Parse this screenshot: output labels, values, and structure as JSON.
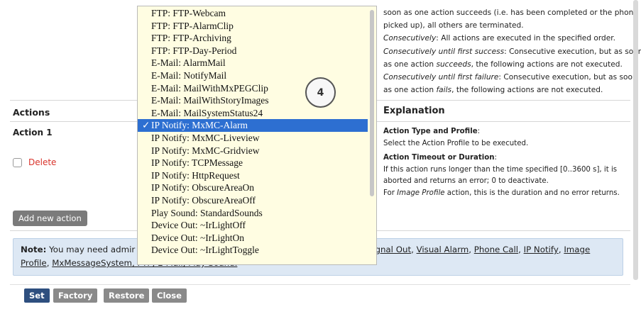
{
  "top_explanation": {
    "line1": "soon as one action succeeds (i.e. has been completed or the phone is",
    "line2": "picked up), all others are terminated.",
    "line3_em": "Consecutively",
    "line3_rest": ": All actions are executed in the specified order.",
    "line4_em": "Consecutively until first success",
    "line4_rest": ": Consecutive execution, but as soon",
    "line5_pre": "as one action ",
    "line5_em": "succeeds",
    "line5_rest": ", the following actions are not executed.",
    "line6_em": "Consecutively until first failure",
    "line6_rest": ": Consecutive execution, but as soon",
    "line7_pre": "as one action ",
    "line7_em": "fails",
    "line7_rest": ", the following actions are not executed."
  },
  "table": {
    "actions_header": "Actions",
    "explanation_header": "Explanation",
    "action_name": "Action 1",
    "delete_label": "Delete",
    "delete_checked": false
  },
  "explanation": {
    "type_title": "Action Type and Profile",
    "type_colon": ":",
    "type_text": "Select the Action Profile to be executed.",
    "timeout_title": "Action Timeout or Duration",
    "timeout_colon": ":",
    "timeout_line1": "If this action runs longer than the time specified [0..3600 s], it is",
    "timeout_line2": "aborted and returns an error; 0 to deactivate.",
    "timeout_line3_pre": "For ",
    "timeout_line3_em": "Image Profile",
    "timeout_line3_rest": " action, this is the duration and no error returns."
  },
  "add_button": "Add new action",
  "note": {
    "bold": "Note:",
    "text": " You may need admir",
    "links_line1": [
      "Signal Out",
      "Visual Alarm",
      "Phone Call",
      "IP Notify",
      "Image"
    ],
    "line2_link1": "Profile",
    "line2_sep": ", ",
    "line2_link2": "MxMessageSystem",
    "line2_tail": ", FTP, E-Mail, Play Sound."
  },
  "buttons": {
    "set": "Set",
    "factory": "Factory",
    "restore": "Restore",
    "close": "Close"
  },
  "dropdown": {
    "items": [
      "FTP: FTP-Webcam",
      "FTP: FTP-AlarmClip",
      "FTP: FTP-Archiving",
      "FTP: FTP-Day-Period",
      "E-Mail: AlarmMail",
      "E-Mail: NotifyMail",
      "E-Mail: MailWithMxPEGClip",
      "E-Mail: MailWithStoryImages",
      "E-Mail: MailSystemStatus24",
      "IP Notify: MxMC-Alarm",
      "IP Notify: MxMC-Liveview",
      "IP Notify: MxMC-Gridview",
      "IP Notify: TCPMessage",
      "IP Notify: HttpRequest",
      "IP Notify: ObscureAreaOn",
      "IP Notify: ObscureAreaOff",
      "Play Sound: StandardSounds",
      "Device Out: ~IrLightOff",
      "Device Out: ~IrLightOn",
      "Device Out: ~IrLightToggle"
    ],
    "selected_index": 9,
    "check_mark": "✓"
  },
  "callout": "4",
  "colors": {
    "selected_bg": "#2d6fd1",
    "dropdown_bg": "#fffde2",
    "delete_red": "#d9332b",
    "set_button": "#2e4f7f",
    "note_bg": "#dde8f4"
  }
}
